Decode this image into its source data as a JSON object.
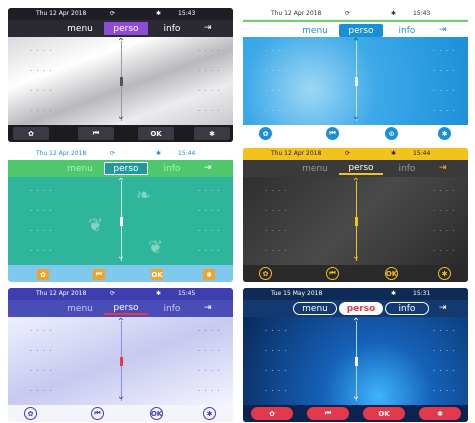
{
  "panels": [
    {
      "theme": "dark-violet",
      "status": {
        "date": "Thu 12 Apr 2018",
        "sync": "⟳",
        "bt": "✱",
        "time": "15:43"
      },
      "tabs": [
        "menu",
        "perso",
        "info"
      ],
      "exit": "⇥",
      "softkeys": [
        "✿",
        "⏮",
        "OK",
        "✱"
      ],
      "dots": "· · · ·"
    },
    {
      "theme": "light-blue",
      "status": {
        "date": "Thu 12 Apr 2018",
        "sync": "⟳",
        "bt": "✱",
        "time": "15:43"
      },
      "tabs": [
        "menu",
        "perso",
        "info"
      ],
      "exit": "⇥",
      "softkeys": [
        "✿",
        "⏮",
        "⊙",
        "✱"
      ],
      "dots": "· · · ·"
    },
    {
      "theme": "green-teal",
      "status": {
        "date": "Thu 12 Apr 2018",
        "sync": "⟳",
        "bt": "✱",
        "time": "15:44"
      },
      "tabs": [
        "menu",
        "perso",
        "info"
      ],
      "exit": "⇥",
      "softkeys": [
        "✿",
        "⏮",
        "OK",
        "✱"
      ],
      "dots": "· · · ·"
    },
    {
      "theme": "dark-yellow",
      "status": {
        "date": "Thu 12 Apr 2018",
        "sync": "⟳",
        "bt": "✱",
        "time": "15:44"
      },
      "tabs": [
        "menu",
        "perso",
        "info"
      ],
      "exit": "⇥",
      "softkeys": [
        "✿",
        "⏮",
        "OK",
        "✱"
      ],
      "dots": "· · · ·"
    },
    {
      "theme": "indigo",
      "status": {
        "date": "Thu 12 Apr 2018",
        "sync": "⟳",
        "bt": "✱",
        "time": "15:45"
      },
      "tabs": [
        "menu",
        "perso",
        "info"
      ],
      "exit": "⇥",
      "softkeys": [
        "✿",
        "⏮",
        "OK",
        "✱"
      ],
      "dots": "· · · ·"
    },
    {
      "theme": "deep-blue",
      "status": {
        "date": "Tue 15 May 2018",
        "sync": "",
        "bt": "✱",
        "time": "15:31"
      },
      "tabs": [
        "menu",
        "perso",
        "info"
      ],
      "exit": "⇥",
      "softkeys": [
        "✿",
        "⏮",
        "OK",
        "✱"
      ],
      "dots": "· · · ·"
    }
  ],
  "icons": {
    "up": "chevron-up-icon",
    "down": "chevron-down-icon",
    "exit": "exit-icon",
    "settings": "settings-icon",
    "back": "skip-back-icon",
    "ok": "ok-icon",
    "bluetooth": "bluetooth-icon"
  }
}
